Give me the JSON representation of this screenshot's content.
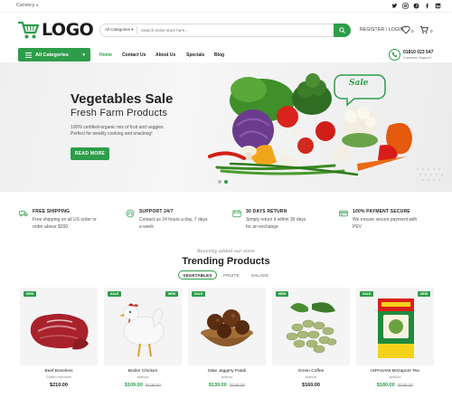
{
  "topbar": {
    "currency_label": "Currency"
  },
  "header": {
    "logo_text": "LOGO",
    "search": {
      "category": "All Categories",
      "placeholder": "Search entire store here..."
    },
    "login_label": "REGISTER / LOGIN",
    "wishlist_count": "0",
    "cart_count": "0"
  },
  "nav": {
    "all_categories": "All Categories",
    "items": [
      "Home",
      "Contact Us",
      "About Us",
      "Specials",
      "Blog"
    ],
    "phone": "01810 023 547",
    "phone_sub": "Customer Support"
  },
  "hero": {
    "title": "Vegetables Sale",
    "subtitle": "Fresh Farm Products",
    "line1": "100% certified-organic mix of fruit and veggies.",
    "line2": "Perfect for weekly cooking and snacking!",
    "button": "READ MORE",
    "bubble": "Sale"
  },
  "features": [
    {
      "icon": "truck-icon",
      "title": "FREE SHIPPING",
      "line1": "Free shipping on all US order or",
      "line2": "order above $200"
    },
    {
      "icon": "support-icon",
      "title": "SUPPORT 24/7",
      "line1": "Contact us 24 hours a day, 7 days",
      "line2": "a week"
    },
    {
      "icon": "return-icon",
      "title": "30 DAYS RETURN",
      "line1": "Simply return it within 30 days",
      "line2": "for an exchange"
    },
    {
      "icon": "card-icon",
      "title": "100% PAYMENT SECURE",
      "line1": "We ensure secure payment with",
      "line2": "PEV"
    }
  ],
  "trending": {
    "kicker": "Recently added our store",
    "title": "Trending Products",
    "tabs": [
      "VEGETABLES",
      "FRUITS",
      "SALADS"
    ]
  },
  "products": [
    {
      "badge": "NEW",
      "name": "Beef Boneless",
      "category": "Golden Harvester",
      "price": "$210.00",
      "old": ""
    },
    {
      "badge": "SALE",
      "badge2": "NEW",
      "name": "Broiler Chicken",
      "category": "seafood",
      "price": "$109.00",
      "old": "$109.00"
    },
    {
      "badge": "SALE",
      "name": "Date Jaggery Patali",
      "category": "seafood",
      "price": "$139.00",
      "old": "$150.00"
    },
    {
      "badge": "NEW",
      "name": "Green Coffee",
      "category": "seafood",
      "price": "$160.00",
      "old": ""
    },
    {
      "badge": "SALE",
      "badge2": "NEW",
      "name": "ISPAHANI Mirzapore Tea",
      "category": "seafood",
      "price": "$180.00",
      "old": "$190.00"
    }
  ],
  "colors": {
    "accent": "#2e9d4a",
    "text": "#222222"
  }
}
